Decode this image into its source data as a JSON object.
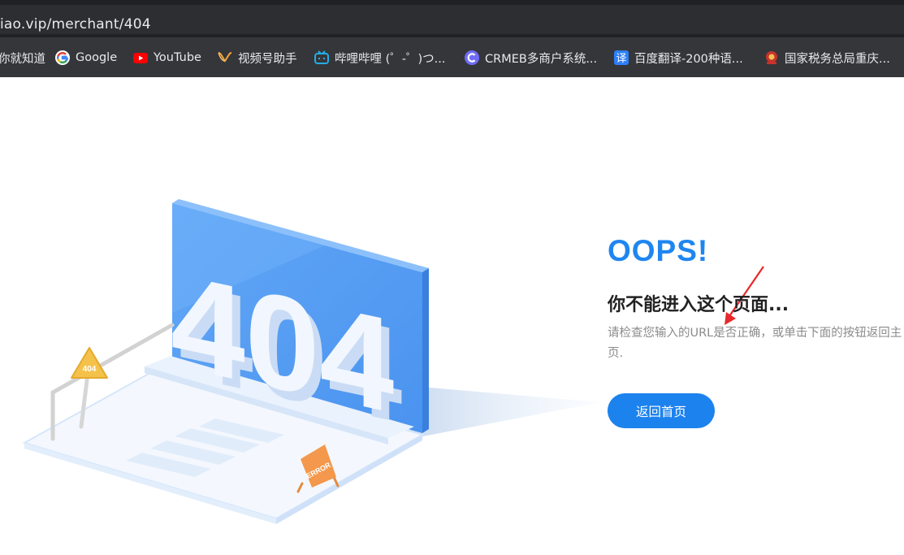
{
  "browser": {
    "url": "iao.vip/merchant/404",
    "bookmarks": [
      {
        "label": "你就知道",
        "icon": "none"
      },
      {
        "label": "Google",
        "icon": "google-icon"
      },
      {
        "label": "YouTube",
        "icon": "youtube-icon"
      },
      {
        "label": "视频号助手",
        "icon": "channels-icon"
      },
      {
        "label": "哔哩哔哩 (゜-゜)つ...",
        "icon": "bilibili-icon"
      },
      {
        "label": "CRMEB多商户系统...",
        "icon": "crmeb-icon"
      },
      {
        "label": "百度翻译-200种语...",
        "icon": "baidu-translate-icon"
      },
      {
        "label": "国家税务总局重庆...",
        "icon": "tax-bureau-icon"
      }
    ]
  },
  "error_page": {
    "oops": "OOPS!",
    "headline": "你不能进入这个页面...",
    "description": "请检查您输入的URL是否正确，或单击下面的按钮返回主页.",
    "home_button": "返回首页",
    "illustration": {
      "big_number": "404",
      "sign_text": "404",
      "board_text": "ERROR"
    }
  },
  "colors": {
    "accent": "#1e86f0",
    "button": "#1c82ee",
    "annotation": "#e8282b",
    "chrome_dark": "#202124",
    "bookmarks_bg": "#35363a"
  }
}
